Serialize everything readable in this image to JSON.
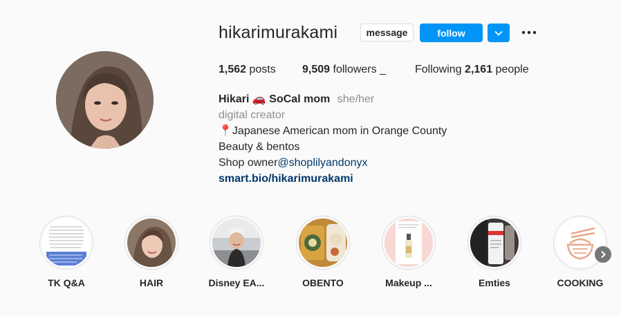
{
  "profile": {
    "username": "hikarimurakami",
    "message_label": "message",
    "follow_label": "follow",
    "posts_count": "1,562",
    "posts_label": "posts",
    "followers_count": "9,509",
    "followers_label": "followers _",
    "following_prefix": "Following",
    "following_count": "2,161",
    "following_suffix": "people"
  },
  "bio": {
    "name_first": "Hikari",
    "name_emoji": "🚗",
    "name_rest": "SoCal mom",
    "pronouns": "she/her",
    "category": "digital creator",
    "line1_pin": "📍",
    "line1": "Japanese American mom in Orange County",
    "line2": "Beauty & bentos",
    "line3_prefix": "Shop owner",
    "line3_mention": "@shoplilyandonyx",
    "link": "smart.bio/hikarimurakami"
  },
  "highlights": [
    {
      "label": "TK Q&A"
    },
    {
      "label": "HAIR"
    },
    {
      "label": "Disney EA..."
    },
    {
      "label": "OBENTO"
    },
    {
      "label": "Makeup ..."
    },
    {
      "label": "Emties"
    },
    {
      "label": "COOKING"
    }
  ],
  "icons": {
    "dropdown": "chevron-down-icon",
    "more": "more-horizontal-icon",
    "next": "chevron-right-icon"
  },
  "colors": {
    "accent": "#0095f6",
    "link": "#00376b",
    "muted": "#8e8e8e",
    "background": "#fafafa"
  }
}
